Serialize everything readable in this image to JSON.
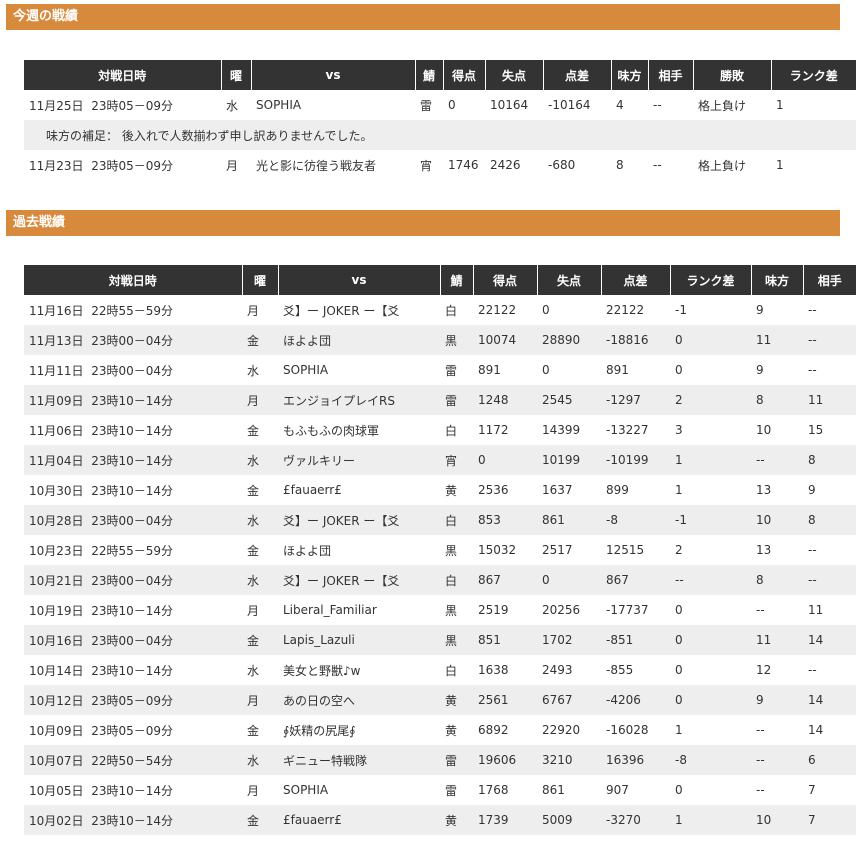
{
  "this_week": {
    "title": "今週の戦績",
    "columns": [
      "対戦日時",
      "曜",
      "vs",
      "鯖",
      "得点",
      "失点",
      "点差",
      "味方",
      "相手",
      "勝敗",
      "ランク差"
    ],
    "rows": [
      {
        "date": "11月25日",
        "time": "23時05－09分",
        "day": "水",
        "vs": "SOPHIA",
        "server": "雷",
        "score": "0",
        "lost": "10164",
        "diff": "-10164",
        "ally": "4",
        "enemy": "--",
        "result": "格上負け",
        "rank": "1"
      },
      {
        "date": "11月23日",
        "time": "23時05－09分",
        "day": "月",
        "vs": "光と影に彷徨う戦友者",
        "server": "宵",
        "score": "1746",
        "lost": "2426",
        "diff": "-680",
        "ally": "8",
        "enemy": "--",
        "result": "格上負け",
        "rank": "1"
      }
    ],
    "note": "味方の補足： 後入れで人数揃わず申し訳ありませんでした。"
  },
  "past": {
    "title": "過去戦績",
    "columns": [
      "対戦日時",
      "曜",
      "vs",
      "鯖",
      "得点",
      "失点",
      "点差",
      "ランク差",
      "味方",
      "相手"
    ],
    "rows": [
      {
        "date": "11月16日",
        "time": "22時55－59分",
        "day": "月",
        "vs": "爻】ー JOKER ー【爻",
        "server": "白",
        "score": "22122",
        "lost": "0",
        "diff": "22122",
        "rank": "-1",
        "ally": "9",
        "enemy": "--"
      },
      {
        "date": "11月13日",
        "time": "23時00－04分",
        "day": "金",
        "vs": "ほよよ団",
        "server": "黒",
        "score": "10074",
        "lost": "28890",
        "diff": "-18816",
        "rank": "0",
        "ally": "11",
        "enemy": "--"
      },
      {
        "date": "11月11日",
        "time": "23時00－04分",
        "day": "水",
        "vs": "SOPHIA",
        "server": "雷",
        "score": "891",
        "lost": "0",
        "diff": "891",
        "rank": "0",
        "ally": "9",
        "enemy": "--"
      },
      {
        "date": "11月09日",
        "time": "23時10－14分",
        "day": "月",
        "vs": "エンジョイプレイRS",
        "server": "雷",
        "score": "1248",
        "lost": "2545",
        "diff": "-1297",
        "rank": "2",
        "ally": "8",
        "enemy": "11"
      },
      {
        "date": "11月06日",
        "time": "23時10－14分",
        "day": "金",
        "vs": "もふもふの肉球軍",
        "server": "白",
        "score": "1172",
        "lost": "14399",
        "diff": "-13227",
        "rank": "3",
        "ally": "10",
        "enemy": "15"
      },
      {
        "date": "11月04日",
        "time": "23時10－14分",
        "day": "水",
        "vs": "ヴァルキリー",
        "server": "宵",
        "score": "0",
        "lost": "10199",
        "diff": "-10199",
        "rank": "1",
        "ally": "--",
        "enemy": "8"
      },
      {
        "date": "10月30日",
        "time": "23時10－14分",
        "day": "金",
        "vs": "£fauaerr£",
        "server": "黄",
        "score": "2536",
        "lost": "1637",
        "diff": "899",
        "rank": "1",
        "ally": "13",
        "enemy": "9"
      },
      {
        "date": "10月28日",
        "time": "23時00－04分",
        "day": "水",
        "vs": "爻】ー JOKER ー【爻",
        "server": "白",
        "score": "853",
        "lost": "861",
        "diff": "-8",
        "rank": "-1",
        "ally": "10",
        "enemy": "8"
      },
      {
        "date": "10月23日",
        "time": "22時55－59分",
        "day": "金",
        "vs": "ほよよ団",
        "server": "黒",
        "score": "15032",
        "lost": "2517",
        "diff": "12515",
        "rank": "2",
        "ally": "13",
        "enemy": "--"
      },
      {
        "date": "10月21日",
        "time": "23時00－04分",
        "day": "水",
        "vs": "爻】ー JOKER ー【爻",
        "server": "白",
        "score": "867",
        "lost": "0",
        "diff": "867",
        "rank": "--",
        "ally": "8",
        "enemy": "--"
      },
      {
        "date": "10月19日",
        "time": "23時10－14分",
        "day": "月",
        "vs": "Liberal_Familiar",
        "server": "黒",
        "score": "2519",
        "lost": "20256",
        "diff": "-17737",
        "rank": "0",
        "ally": "--",
        "enemy": "11"
      },
      {
        "date": "10月16日",
        "time": "23時00－04分",
        "day": "金",
        "vs": "Lapis_Lazuli",
        "server": "黒",
        "score": "851",
        "lost": "1702",
        "diff": "-851",
        "rank": "0",
        "ally": "11",
        "enemy": "14"
      },
      {
        "date": "10月14日",
        "time": "23時10－14分",
        "day": "水",
        "vs": "美女と野獣♪w",
        "server": "白",
        "score": "1638",
        "lost": "2493",
        "diff": "-855",
        "rank": "0",
        "ally": "12",
        "enemy": "--"
      },
      {
        "date": "10月12日",
        "time": "23時05－09分",
        "day": "月",
        "vs": "あの日の空へ",
        "server": "黄",
        "score": "2561",
        "lost": "6767",
        "diff": "-4206",
        "rank": "0",
        "ally": "9",
        "enemy": "14"
      },
      {
        "date": "10月09日",
        "time": "23時05－09分",
        "day": "金",
        "vs": "∮妖精の尻尾∮",
        "server": "黄",
        "score": "6892",
        "lost": "22920",
        "diff": "-16028",
        "rank": "1",
        "ally": "--",
        "enemy": "14"
      },
      {
        "date": "10月07日",
        "time": "22時50－54分",
        "day": "水",
        "vs": "ギニュー特戦隊",
        "server": "雷",
        "score": "19606",
        "lost": "3210",
        "diff": "16396",
        "rank": "-8",
        "ally": "--",
        "enemy": "6"
      },
      {
        "date": "10月05日",
        "time": "23時10－14分",
        "day": "月",
        "vs": "SOPHIA",
        "server": "雷",
        "score": "1768",
        "lost": "861",
        "diff": "907",
        "rank": "0",
        "ally": "--",
        "enemy": "7"
      },
      {
        "date": "10月02日",
        "time": "23時10－14分",
        "day": "金",
        "vs": "£fauaerr£",
        "server": "黄",
        "score": "1739",
        "lost": "5009",
        "diff": "-3270",
        "rank": "1",
        "ally": "10",
        "enemy": "7"
      }
    ]
  },
  "colors": {
    "section_bar": "#d88a3c",
    "header_bg": "#333333",
    "row_alt": "#eeeeee"
  }
}
